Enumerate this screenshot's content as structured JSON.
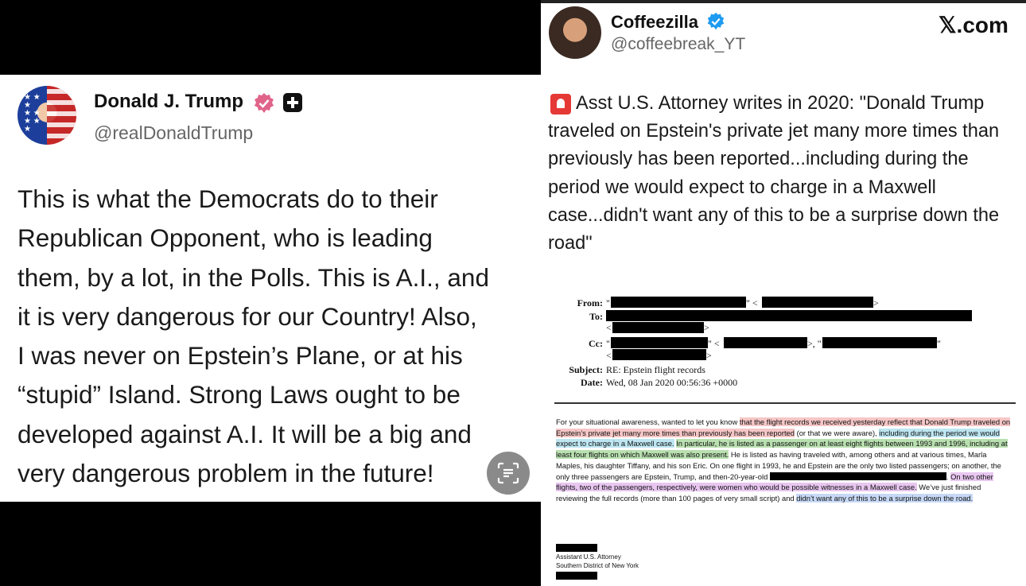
{
  "left_post": {
    "name": "Donald J. Trump",
    "handle": "@realDonaldTrump",
    "body": "This is what the Democrats do to their\nRepublican Opponent, who is leading\nthem, by a lot, in the Polls. This is A.I., and\nit is very dangerous for our Country! Also,\nI was never on Epstein’s Plane, or at his\n“stupid” Island. Strong Laws ought to be\ndeveloped against A.I. It will be a big and\nvery dangerous problem in the future!"
  },
  "right_post": {
    "name": "Coffeezilla",
    "handle": "@coffeebreak_YT",
    "site": "𝕏.com",
    "body": "Asst U.S. Attorney writes in 2020: \"Donald Trump traveled on Epstein's private jet many more times than previously has been reported...including during the period we would expect to charge in a Maxwell case...didn't want any of this to be a surprise down the road\""
  },
  "document": {
    "from_label": "From:",
    "to_label": "To:",
    "cc_label": "Cc:",
    "subject_label": "Subject:",
    "subject": "RE: Epstein flight records",
    "date_label": "Date:",
    "date": "Wed, 08 Jan 2020 00:56:36 +0000",
    "body_segments": {
      "s1": "For your situational awareness, wanted to let you know ",
      "s2": "that the flight records we received yesterday reflect that Donald Trump traveled on Epstein’s private jet many more times than previously has been reported",
      "s3": " (or that we were aware), ",
      "s4": "including during the period we would expect to charge in a Maxwell case.",
      "s5": " ",
      "s6": "In particular, he is listed as a passenger on at least eight flights between 1993 and 1996, including at least four flights on which Maxwell was also present.",
      "s7": " He is listed as having traveled with, among others and at various times, Marla Maples, his daughter Tiffany, and his son Eric.  On one flight in 1993, he and Epstein are the only two listed passengers; on another, the only three passengers are Epstein, Trump, and then-20-year-old ",
      "s8": ". ",
      "s9": "On two other flights, two of the passengers, respectively, were women who would be possible witnesses in a Maxwell case.",
      "s10": "  We’ve just finished reviewing the full records (more than 100 pages of very small script) and ",
      "s11": "didn’t want any of this to be a surprise down the road."
    },
    "signature_title": "Assistant U.S. Attorney",
    "signature_office": "Southern District of New York"
  }
}
